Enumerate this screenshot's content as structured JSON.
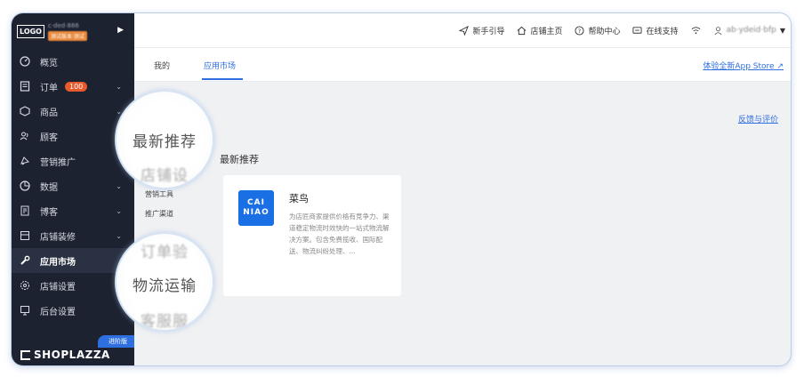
{
  "sidebar": {
    "logo": "LOGO",
    "shop_name": "c·ded·886",
    "shop_badge": "测试版本·测试",
    "items": [
      {
        "label": "概览",
        "icon": "dashboard-icon",
        "chevron": false
      },
      {
        "label": "订单",
        "icon": "order-icon",
        "chevron": true,
        "badge": "100"
      },
      {
        "label": "商品",
        "icon": "product-icon",
        "chevron": true
      },
      {
        "label": "顾客",
        "icon": "customers-icon",
        "chevron": false
      },
      {
        "label": "营销推广",
        "icon": "marketing-icon",
        "chevron": false
      },
      {
        "label": "数据",
        "icon": "data-icon",
        "chevron": true
      },
      {
        "label": "博客",
        "icon": "blog-icon",
        "chevron": true
      },
      {
        "label": "店铺装修",
        "icon": "store-design-icon",
        "chevron": true
      },
      {
        "label": "应用市场",
        "icon": "app-market-icon",
        "chevron": false,
        "active": true
      },
      {
        "label": "店铺设置",
        "icon": "store-settings-icon",
        "chevron": false
      },
      {
        "label": "后台设置",
        "icon": "admin-settings-icon",
        "chevron": false
      }
    ],
    "edition": "进阶版",
    "brand": "SHOPLAZZA"
  },
  "topbar": {
    "guide": "新手引导",
    "store_home": "店铺主页",
    "help": "帮助中心",
    "support": "在线支持",
    "user": "ab·ydeid·bfp"
  },
  "tabs": {
    "mine": "我的",
    "market": "应用市场"
  },
  "links": {
    "new_store": "体验全新App Store",
    "feedback": "反馈与评价"
  },
  "section": {
    "title": "最新推荐",
    "sub1": "营销工具",
    "sub2": "推广渠道"
  },
  "card": {
    "logo_line1": "CAI",
    "logo_line2": "NIAO",
    "title": "菜鸟",
    "desc": "为店匠商家提供价格有竞争力、渠道稳定物流时效快的一站式物流解决方案。包含免费揽收、国际配送、物流纠纷处理、..."
  },
  "magnifier": {
    "top_line1": "最新推荐",
    "top_line2": "店铺设",
    "bottom_line1": "订单验",
    "bottom_line2": "物流运输",
    "bottom_line3": "客服服"
  },
  "colors": {
    "accent": "#2f6fe0",
    "sidebar_bg": "#1d2230",
    "badge": "#e8592b",
    "cainiao": "#1a6fe5"
  }
}
